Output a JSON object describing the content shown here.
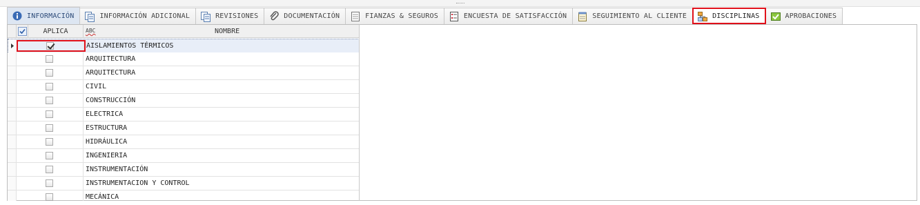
{
  "tabs": [
    {
      "label": "INFORMACIÓN",
      "icon": "info-icon"
    },
    {
      "label": "INFORMACIÓN ADICIONAL",
      "icon": "documents-icon"
    },
    {
      "label": "REVISIONES",
      "icon": "documents-icon"
    },
    {
      "label": "DOCUMENTACIÓN",
      "icon": "paperclip-icon"
    },
    {
      "label": "FIANZAS & SEGUROS",
      "icon": "ledger-icon"
    },
    {
      "label": "ENCUESTA DE SATISFACCIÓN",
      "icon": "numbered-list-icon"
    },
    {
      "label": "SEGUIMIENTO AL CLIENTE",
      "icon": "notepad-icon"
    },
    {
      "label": "DISCIPLINAS",
      "icon": "org-chart-icon"
    },
    {
      "label": "APROBACIONES",
      "icon": "approval-check-icon"
    }
  ],
  "active_tab": "INFORMACIÓN",
  "highlighted_tab": "DISCIPLINAS",
  "grid": {
    "col_aplica": "APLICA",
    "col_type_glyph": "ABC",
    "col_nombre": "NOMBRE",
    "rows": [
      {
        "aplica": true,
        "nombre": "AISLAMIENTOS TÉRMICOS"
      },
      {
        "aplica": false,
        "nombre": "ARQUITECTURA"
      },
      {
        "aplica": false,
        "nombre": "ARQUITECTURA"
      },
      {
        "aplica": false,
        "nombre": "CIVIL"
      },
      {
        "aplica": false,
        "nombre": "CONSTRUCCIÓN"
      },
      {
        "aplica": false,
        "nombre": "ELECTRICA"
      },
      {
        "aplica": false,
        "nombre": "ESTRUCTURA"
      },
      {
        "aplica": false,
        "nombre": "HIDRÁULICA"
      },
      {
        "aplica": false,
        "nombre": "INGENIERIA"
      },
      {
        "aplica": false,
        "nombre": "INSTRUMENTACIÓN"
      },
      {
        "aplica": false,
        "nombre": "INSTRUMENTACION Y CONTROL"
      },
      {
        "aplica": false,
        "nombre": "MECÁNICA"
      }
    ]
  },
  "colors": {
    "highlight": "#e0101a",
    "selected_row": "#e8eef8"
  }
}
